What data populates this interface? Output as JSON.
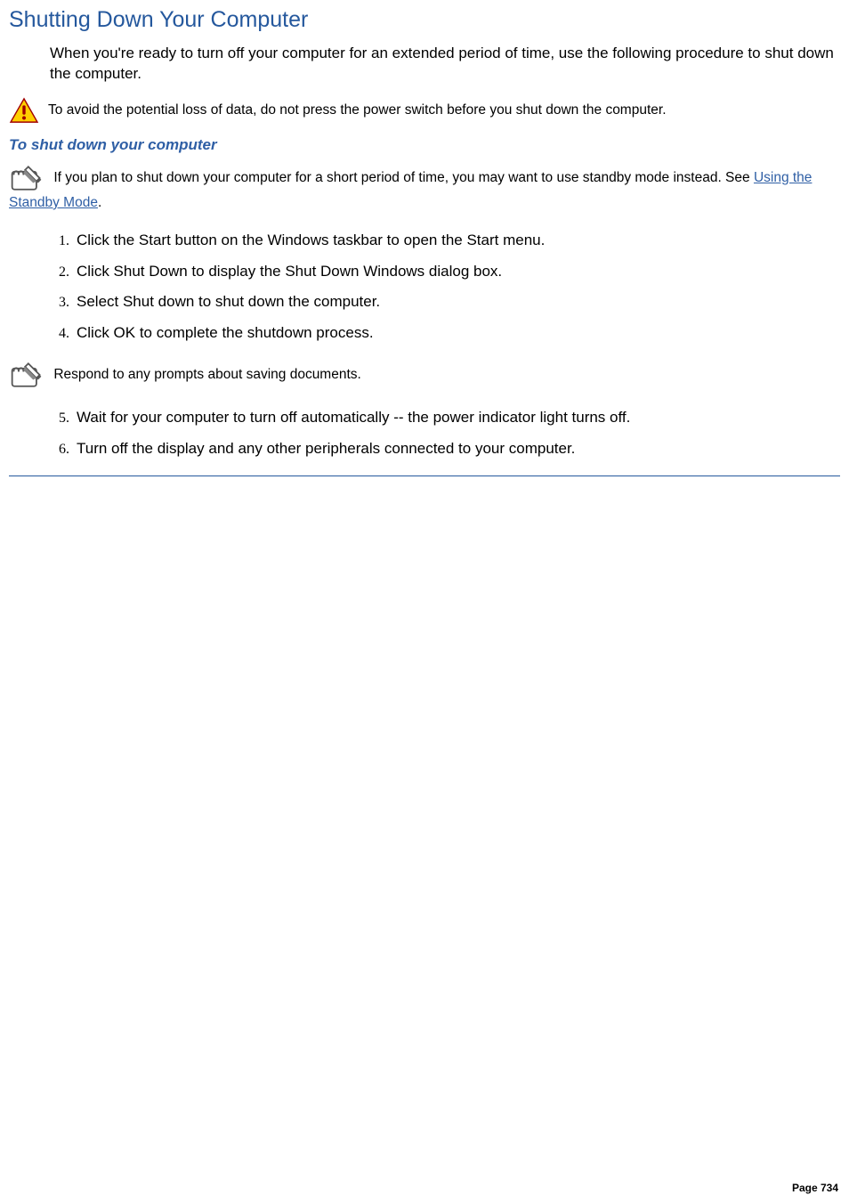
{
  "title": "Shutting Down Your Computer",
  "intro": "When you're ready to turn off your computer for an extended period of time, use the following procedure to shut down the computer.",
  "warning_text": "To avoid the potential loss of data, do not press the power switch before you shut down the computer.",
  "subhead": "To shut down your computer",
  "note1_part1": "If you plan to shut down your computer for a short period of time, you may want to use standby mode instead. See ",
  "note1_link_text": "Using the Standby Mode",
  "note1_part2": ".",
  "steps": {
    "s1": "Click the Start button on the Windows taskbar to open the Start menu.",
    "s2": "Click Shut Down to display the Shut Down Windows dialog box.",
    "s3": "Select Shut down to shut down the computer.",
    "s4": "Click OK to complete the shutdown process.",
    "s5": "Wait for your computer to turn off automatically -- the power indicator light turns off.",
    "s6": "Turn off the display and any other peripherals connected to your computer."
  },
  "inline_note_text": "Respond to any prompts about saving documents.",
  "page_number": "Page 734"
}
